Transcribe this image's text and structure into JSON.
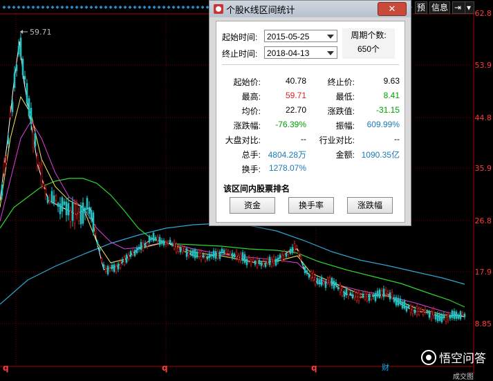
{
  "top_buttons": {
    "yu": "预",
    "xinxi": "信息"
  },
  "price_axis": [
    "62.8",
    "53.9",
    "44.8",
    "35.9",
    "26.8",
    "17.9",
    "8.85"
  ],
  "peak_label": "59.71",
  "bottom_markers": [
    "q",
    "q",
    "q"
  ],
  "cai": "财",
  "watermark": "悟空问答",
  "bottom_right_text": "成交图",
  "dialog": {
    "title": "个股K线区间统计",
    "close": "✕",
    "start_label": "起始时间:",
    "start_value": "2015-05-25",
    "end_label": "终止时间:",
    "end_value": "2018-04-13",
    "period_label": "周期个数:",
    "period_value": "650个",
    "stats": {
      "start_price_label": "起始价:",
      "start_price": "40.78",
      "end_price_label": "终止价:",
      "end_price": "9.63",
      "high_label": "最高:",
      "high": "59.71",
      "low_label": "最低:",
      "low": "8.41",
      "avg_label": "均价:",
      "avg": "22.70",
      "change_label": "涨跌值:",
      "change": "-31.15",
      "change_pct_label": "涨跌幅:",
      "change_pct": "-76.39%",
      "amplitude_label": "振幅:",
      "amplitude": "609.99%",
      "market_cmp_label": "大盘对比:",
      "market_cmp": "--",
      "industry_cmp_label": "行业对比:",
      "industry_cmp": "--",
      "volume_label": "总手:",
      "volume": "4804.28万",
      "amount_label": "金额:",
      "amount": "1090.35亿",
      "turnover_label": "换手:",
      "turnover": "1278.07%"
    },
    "rank_title": "该区间内股票排名",
    "buttons": [
      "资金",
      "换手率",
      "涨跌幅"
    ]
  },
  "colors": {
    "up": "#e02020",
    "down": "#00a000",
    "blue": "#1a7ab8",
    "axis_red": "#ff3b3b"
  }
}
